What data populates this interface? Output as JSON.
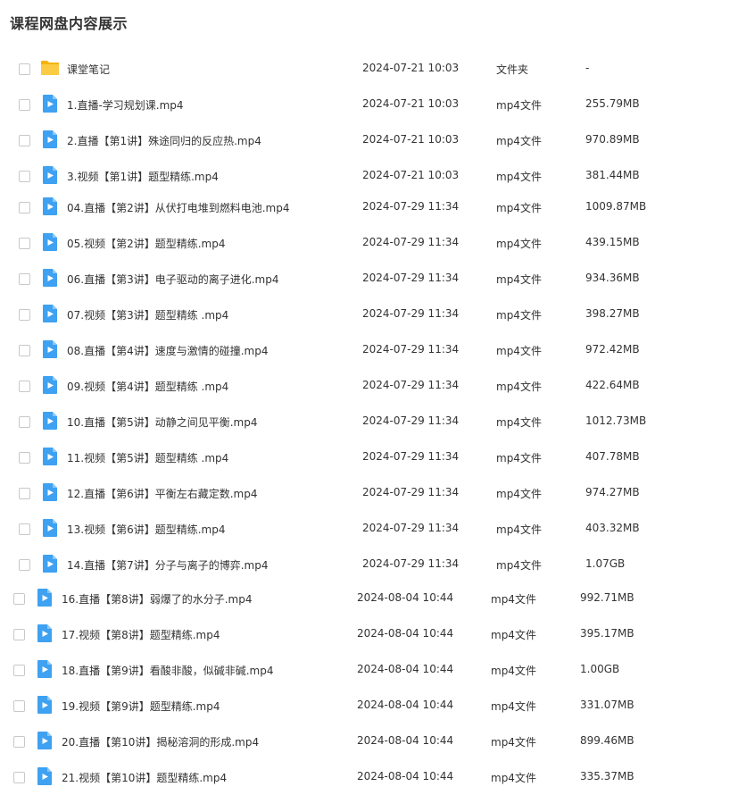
{
  "title": "课程网盘内容展示",
  "files": [
    {
      "name": "课堂笔记",
      "date": "2024-07-21 10:03",
      "type": "文件夹",
      "size": "-",
      "icon": "folder-icon"
    },
    {
      "name": "1.直播-学习规划课.mp4",
      "date": "2024-07-21 10:03",
      "type": "mp4文件",
      "size": "255.79MB",
      "icon": "video-file-icon"
    },
    {
      "name": "2.直播【第1讲】殊途同归的反应热.mp4",
      "date": "2024-07-21 10:03",
      "type": "mp4文件",
      "size": "970.89MB",
      "icon": "video-file-icon"
    },
    {
      "name": "3.视频【第1讲】题型精练.mp4",
      "date": "2024-07-21 10:03",
      "type": "mp4文件",
      "size": "381.44MB",
      "icon": "video-file-icon"
    },
    {
      "name": "04.直播【第2讲】从伏打电堆到燃料电池.mp4",
      "date": "2024-07-29 11:34",
      "type": "mp4文件",
      "size": "1009.87MB",
      "icon": "video-file-icon"
    },
    {
      "name": "05.视频【第2讲】题型精练.mp4",
      "date": "2024-07-29 11:34",
      "type": "mp4文件",
      "size": "439.15MB",
      "icon": "video-file-icon"
    },
    {
      "name": "06.直播【第3讲】电子驱动的离子进化.mp4",
      "date": "2024-07-29 11:34",
      "type": "mp4文件",
      "size": "934.36MB",
      "icon": "video-file-icon"
    },
    {
      "name": "07.视频【第3讲】题型精练 .mp4",
      "date": "2024-07-29 11:34",
      "type": "mp4文件",
      "size": "398.27MB",
      "icon": "video-file-icon"
    },
    {
      "name": "08.直播【第4讲】速度与激情的碰撞.mp4",
      "date": "2024-07-29 11:34",
      "type": "mp4文件",
      "size": "972.42MB",
      "icon": "video-file-icon"
    },
    {
      "name": "09.视频【第4讲】题型精练 .mp4",
      "date": "2024-07-29 11:34",
      "type": "mp4文件",
      "size": "422.64MB",
      "icon": "video-file-icon"
    },
    {
      "name": "10.直播【第5讲】动静之间见平衡.mp4",
      "date": "2024-07-29 11:34",
      "type": "mp4文件",
      "size": "1012.73MB",
      "icon": "video-file-icon"
    },
    {
      "name": "11.视频【第5讲】题型精练 .mp4",
      "date": "2024-07-29 11:34",
      "type": "mp4文件",
      "size": "407.78MB",
      "icon": "video-file-icon"
    },
    {
      "name": "12.直播【第6讲】平衡左右藏定数.mp4",
      "date": "2024-07-29 11:34",
      "type": "mp4文件",
      "size": "974.27MB",
      "icon": "video-file-icon"
    },
    {
      "name": "13.视频【第6讲】题型精练.mp4",
      "date": "2024-07-29 11:34",
      "type": "mp4文件",
      "size": "403.32MB",
      "icon": "video-file-icon"
    },
    {
      "name": "14.直播【第7讲】分子与离子的博弈.mp4",
      "date": "2024-07-29 11:34",
      "type": "mp4文件",
      "size": "1.07GB",
      "icon": "video-file-icon"
    },
    {
      "name": "16.直播【第8讲】弱爆了的水分子.mp4",
      "date": "2024-08-04 10:44",
      "type": "mp4文件",
      "size": "992.71MB",
      "icon": "video-file-icon"
    },
    {
      "name": "17.视频【第8讲】题型精练.mp4",
      "date": "2024-08-04 10:44",
      "type": "mp4文件",
      "size": "395.17MB",
      "icon": "video-file-icon"
    },
    {
      "name": "18.直播【第9讲】看酸非酸，似碱非碱.mp4",
      "date": "2024-08-04 10:44",
      "type": "mp4文件",
      "size": "1.00GB",
      "icon": "video-file-icon"
    },
    {
      "name": "19.视频【第9讲】题型精练.mp4",
      "date": "2024-08-04 10:44",
      "type": "mp4文件",
      "size": "331.07MB",
      "icon": "video-file-icon"
    },
    {
      "name": "20.直播【第10讲】揭秘溶洞的形成.mp4",
      "date": "2024-08-04 10:44",
      "type": "mp4文件",
      "size": "899.46MB",
      "icon": "video-file-icon"
    },
    {
      "name": "21.视频【第10讲】题型精练.mp4",
      "date": "2024-08-04 10:44",
      "type": "mp4文件",
      "size": "335.37MB",
      "icon": "video-file-icon"
    }
  ],
  "colors": {
    "folder": "#f9c233",
    "video": "#3ea1f2",
    "text": "#333333",
    "checkbox_border": "#c8c8c8"
  }
}
